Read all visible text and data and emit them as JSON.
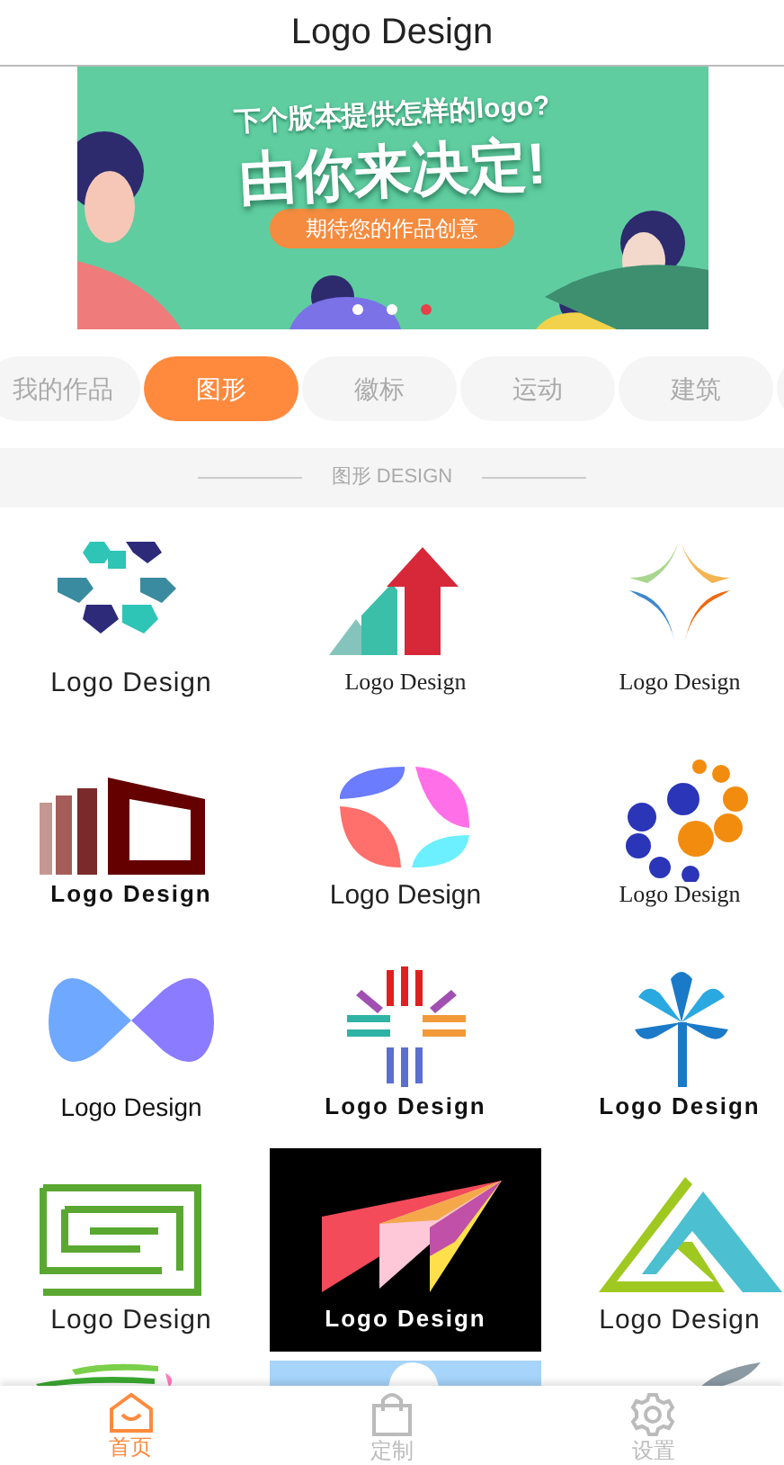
{
  "header": {
    "title": "Logo Design"
  },
  "banner": {
    "headline": "下个版本提供怎样的logo?",
    "slogan": "由你来决定!",
    "cta": "期待您的作品创意",
    "dots": [
      {
        "selected": false
      },
      {
        "selected": false
      },
      {
        "selected": true
      }
    ]
  },
  "tabs": [
    {
      "label": "我的作品",
      "selected": false
    },
    {
      "label": "图形",
      "selected": true
    },
    {
      "label": "徽标",
      "selected": false
    },
    {
      "label": "运动",
      "selected": false
    },
    {
      "label": "建筑",
      "selected": false
    }
  ],
  "section": {
    "title": "图形 DESIGN"
  },
  "tiles": [
    {
      "kind": "hexes",
      "caption": "Logo Design"
    },
    {
      "kind": "arrows",
      "caption": "Logo Design"
    },
    {
      "kind": "sparks",
      "caption": "Logo Design"
    },
    {
      "kind": "bars",
      "caption": "Logo Design"
    },
    {
      "kind": "petals",
      "caption": "Logo Design"
    },
    {
      "kind": "dots",
      "caption": "Logo Design"
    },
    {
      "kind": "cross",
      "caption": "Logo Design"
    },
    {
      "kind": "sun",
      "caption": "Logo Design"
    },
    {
      "kind": "palm",
      "caption": "Logo Design"
    },
    {
      "kind": "maze",
      "caption": "Logo Design"
    },
    {
      "kind": "plane",
      "caption": "Logo Design"
    },
    {
      "kind": "triangle",
      "caption": "Logo Design"
    },
    {
      "kind": "swoosh"
    },
    {
      "kind": "bird"
    },
    {
      "kind": "leaf"
    }
  ],
  "nav": [
    {
      "label": "首页",
      "selected": true
    },
    {
      "label": "定制",
      "selected": false
    },
    {
      "label": "设置",
      "selected": false
    }
  ]
}
